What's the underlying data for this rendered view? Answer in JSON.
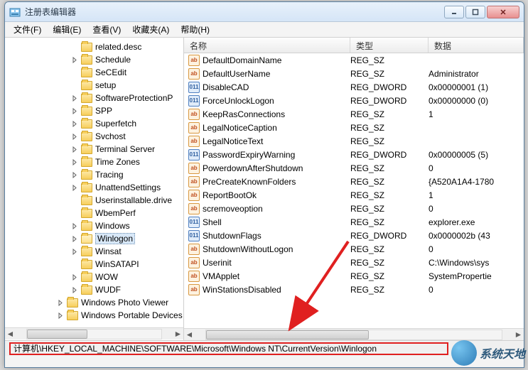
{
  "window": {
    "title": "注册表编辑器"
  },
  "menu": {
    "file": "文件(F)",
    "edit": "编辑(E)",
    "view": "查看(V)",
    "fav": "收藏夹(A)",
    "help": "帮助(H)"
  },
  "cols": {
    "name": "名称",
    "type": "类型",
    "data": "数据"
  },
  "tree": {
    "items": [
      {
        "label": "related.desc",
        "d": 2
      },
      {
        "label": "Schedule",
        "d": 2,
        "exp": true
      },
      {
        "label": "SeCEdit",
        "d": 2
      },
      {
        "label": "setup",
        "d": 2
      },
      {
        "label": "SoftwareProtectionP",
        "d": 2,
        "exp": true
      },
      {
        "label": "SPP",
        "d": 2,
        "exp": true
      },
      {
        "label": "Superfetch",
        "d": 2,
        "exp": true
      },
      {
        "label": "Svchost",
        "d": 2,
        "exp": true
      },
      {
        "label": "Terminal Server",
        "d": 2,
        "exp": true
      },
      {
        "label": "Time Zones",
        "d": 2,
        "exp": true
      },
      {
        "label": "Tracing",
        "d": 2,
        "exp": true
      },
      {
        "label": "UnattendSettings",
        "d": 2,
        "exp": true
      },
      {
        "label": "Userinstallable.drive",
        "d": 2
      },
      {
        "label": "WbemPerf",
        "d": 2
      },
      {
        "label": "Windows",
        "d": 2,
        "exp": true
      },
      {
        "label": "Winlogon",
        "d": 2,
        "exp": true,
        "sel": true
      },
      {
        "label": "Winsat",
        "d": 2,
        "exp": true
      },
      {
        "label": "WinSATAPI",
        "d": 2
      },
      {
        "label": "WOW",
        "d": 2,
        "exp": true
      },
      {
        "label": "WUDF",
        "d": 2,
        "exp": true
      },
      {
        "label": "Windows Photo Viewer",
        "d": 1,
        "exp": true
      },
      {
        "label": "Windows Portable Devices",
        "d": 1,
        "exp": true
      }
    ]
  },
  "values": [
    {
      "n": "DefaultDomainName",
      "t": "REG_SZ",
      "v": "",
      "k": "sz"
    },
    {
      "n": "DefaultUserName",
      "t": "REG_SZ",
      "v": "Administrator",
      "k": "sz"
    },
    {
      "n": "DisableCAD",
      "t": "REG_DWORD",
      "v": "0x00000001 (1)",
      "k": "dw"
    },
    {
      "n": "ForceUnlockLogon",
      "t": "REG_DWORD",
      "v": "0x00000000 (0)",
      "k": "dw"
    },
    {
      "n": "KeepRasConnections",
      "t": "REG_SZ",
      "v": "1",
      "k": "sz"
    },
    {
      "n": "LegalNoticeCaption",
      "t": "REG_SZ",
      "v": "",
      "k": "sz"
    },
    {
      "n": "LegalNoticeText",
      "t": "REG_SZ",
      "v": "",
      "k": "sz"
    },
    {
      "n": "PasswordExpiryWarning",
      "t": "REG_DWORD",
      "v": "0x00000005 (5)",
      "k": "dw"
    },
    {
      "n": "PowerdownAfterShutdown",
      "t": "REG_SZ",
      "v": "0",
      "k": "sz"
    },
    {
      "n": "PreCreateKnownFolders",
      "t": "REG_SZ",
      "v": "{A520A1A4-1780",
      "k": "sz"
    },
    {
      "n": "ReportBootOk",
      "t": "REG_SZ",
      "v": "1",
      "k": "sz"
    },
    {
      "n": "scremoveoption",
      "t": "REG_SZ",
      "v": "0",
      "k": "sz"
    },
    {
      "n": "Shell",
      "t": "REG_SZ",
      "v": "explorer.exe",
      "k": "dw"
    },
    {
      "n": "ShutdownFlags",
      "t": "REG_DWORD",
      "v": "0x0000002b (43",
      "k": "dw"
    },
    {
      "n": "ShutdownWithoutLogon",
      "t": "REG_SZ",
      "v": "0",
      "k": "sz"
    },
    {
      "n": "Userinit",
      "t": "REG_SZ",
      "v": "C:\\Windows\\sys",
      "k": "sz"
    },
    {
      "n": "VMApplet",
      "t": "REG_SZ",
      "v": "SystemPropertie",
      "k": "sz"
    },
    {
      "n": "WinStationsDisabled",
      "t": "REG_SZ",
      "v": "0",
      "k": "sz"
    }
  ],
  "status": {
    "path": "计算机\\HKEY_LOCAL_MACHINE\\SOFTWARE\\Microsoft\\Windows NT\\CurrentVersion\\Winlogon"
  },
  "watermark": {
    "text": "系统天地"
  }
}
